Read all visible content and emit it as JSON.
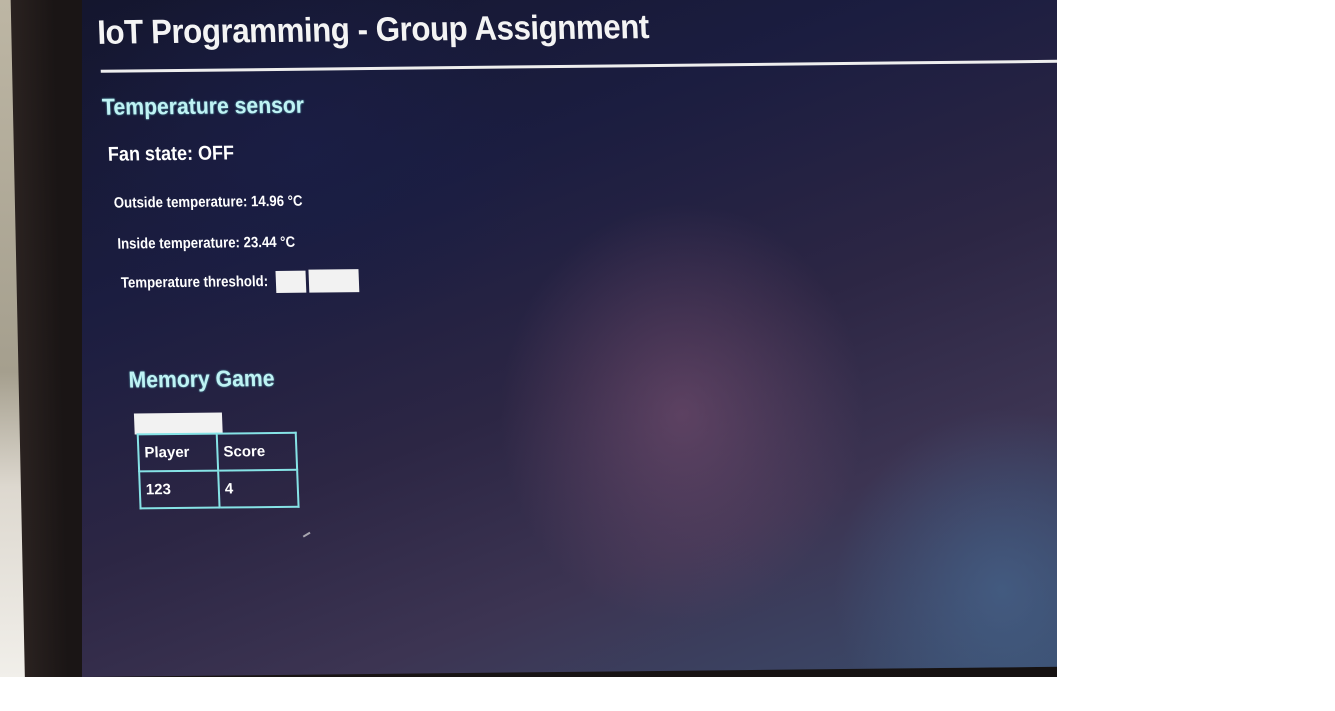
{
  "app": {
    "title": "IoT Programming - Group Assignment"
  },
  "temperature_section": {
    "title": "Temperature sensor",
    "fan_state": "Fan state: OFF",
    "outside_temperature": "Outside temperature: 14.96 °C",
    "inside_temperature": "Inside temperature: 23.44 °C",
    "threshold_label": "Temperature threshold:",
    "threshold_input_value": "",
    "threshold_button_label": ""
  },
  "memory_game_section": {
    "title": "Memory Game",
    "start_button_label": "",
    "table": {
      "headers": [
        "Player",
        "Score"
      ],
      "rows": [
        [
          "123",
          "4"
        ]
      ]
    }
  },
  "colors": {
    "heading_accent": "#bff3f4",
    "table_border": "#86e3e6",
    "background": "#1b1d40"
  }
}
